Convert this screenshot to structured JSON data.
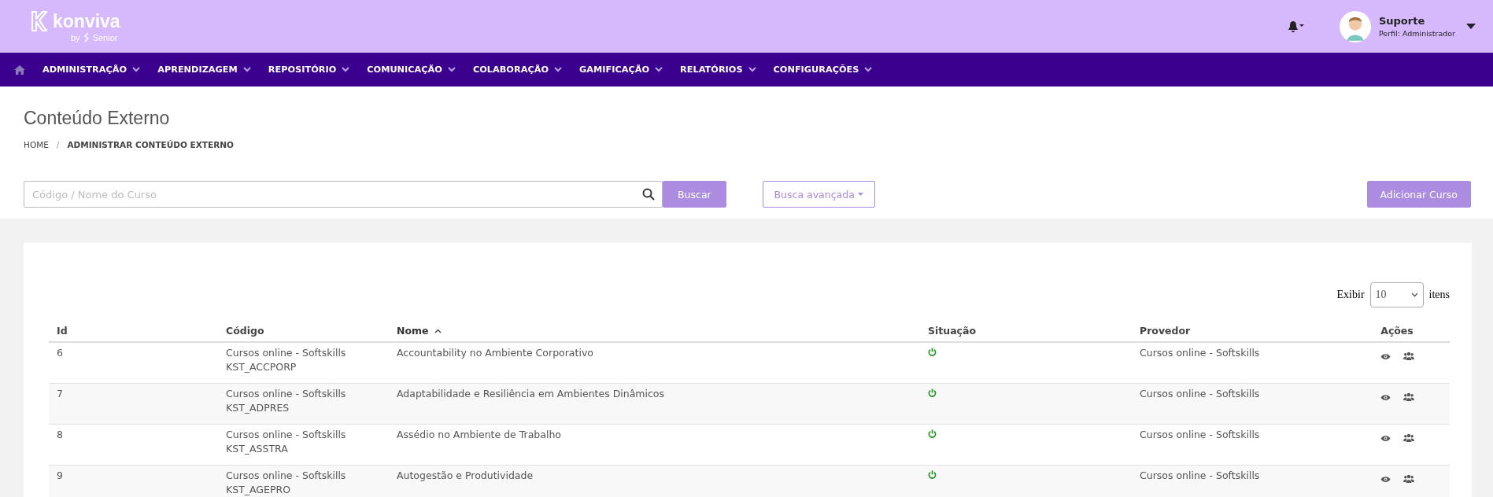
{
  "brand": {
    "name": "konviva",
    "tagline": "by",
    "partner": "Senior"
  },
  "user": {
    "name": "Suporte",
    "profile": "Perfil: Administrador"
  },
  "nav": [
    {
      "label": "ADMINISTRAÇÃO"
    },
    {
      "label": "APRENDIZAGEM"
    },
    {
      "label": "REPOSITÓRIO"
    },
    {
      "label": "COMUNICAÇÃO"
    },
    {
      "label": "COLABORAÇÃO"
    },
    {
      "label": "GAMIFICAÇÃO"
    },
    {
      "label": "RELATÓRIOS"
    },
    {
      "label": "CONFIGURAÇÕES"
    }
  ],
  "page": {
    "title": "Conteúdo Externo",
    "breadcrumb": [
      "HOME",
      "ADMINISTRAR CONTEÚDO EXTERNO"
    ],
    "separator": "/"
  },
  "search": {
    "placeholder": "Código / Nome do Curso",
    "button": "Buscar",
    "advanced": "Busca avançada",
    "add": "Adicionar Curso"
  },
  "paging": {
    "label": "Exibir",
    "value": "10",
    "suffix": "itens"
  },
  "table": {
    "columns": [
      {
        "label": "Id",
        "sorted": false
      },
      {
        "label": "Código",
        "sorted": false
      },
      {
        "label": "Nome",
        "sorted": true
      },
      {
        "label": "Situação",
        "sorted": false
      },
      {
        "label": "Provedor",
        "sorted": false
      },
      {
        "label": "Ações",
        "sorted": false
      }
    ],
    "rows": [
      {
        "id": "6",
        "catalog": "Cursos online - Softskills",
        "code": "KST_ACCPORP",
        "name": "Accountability no Ambiente Corporativo",
        "active": true,
        "provider": "Cursos online - Softskills"
      },
      {
        "id": "7",
        "catalog": "Cursos online - Softskills",
        "code": "KST_ADPRES",
        "name": "Adaptabilidade e Resiliência em Ambientes Dinâmicos",
        "active": true,
        "provider": "Cursos online - Softskills"
      },
      {
        "id": "8",
        "catalog": "Cursos online - Softskills",
        "code": "KST_ASSTRA",
        "name": "Assédio no Ambiente de Trabalho",
        "active": true,
        "provider": "Cursos online - Softskills"
      },
      {
        "id": "9",
        "catalog": "Cursos online - Softskills",
        "code": "KST_AGEPRO",
        "name": "Autogestão e Produtividade",
        "active": true,
        "provider": "Cursos online - Softskills"
      }
    ]
  }
}
